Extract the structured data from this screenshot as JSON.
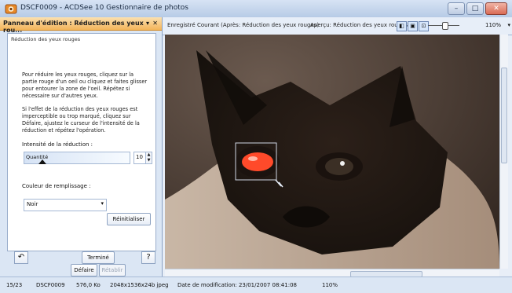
{
  "window": {
    "title": "DSCF0009 - ACDSee 10 Gestionnaire de photos",
    "buttons": {
      "minimize": "–",
      "maximize": "□",
      "close": "✕"
    }
  },
  "panel": {
    "title": "Panneau d'édition : Réduction des yeux rou...",
    "section_header": "Réduction des yeux rouges",
    "para1": "Pour réduire les yeux rouges, cliquez sur la partie rouge d'un oeil ou cliquez et faites glisser pour entourer la zone de l'oeil. Répétez si nécessaire sur d'autres yeux.",
    "para2": "Si l'effet de la réduction des yeux rouges est imperceptible ou trop marqué, cliquez sur Défaire, ajustez le curseur de l'intensité de la réduction et répétez l'opération.",
    "intensity_label": "Intensité de la réduction :",
    "quantity_label": "Quantité",
    "quantity_value": "10",
    "quantity_fraction": 0.1,
    "fill_color_label": "Couleur de remplissage :",
    "fill_color_value": "Noir",
    "reset_label": "Réinitialiser",
    "done_label": "Terminé",
    "undo_label": "Défaire",
    "redo_label": "Rétablir"
  },
  "toolbar": {
    "tab_saved": "Enregistré",
    "tab_current": "Courant (Après: Réduction des yeux rouges)",
    "tab_preview": "Aperçu: Réduction des yeux rouges",
    "zoom_value": "110%"
  },
  "statusbar": {
    "index": "15/23",
    "filename": "DSCF0009",
    "filesize": "576,0 Ko",
    "dimensions": "2048x1536x24b jpeg",
    "modified": "Date de modification: 23/01/2007 08:41:08",
    "zoom": "110%"
  },
  "colors": {
    "panel_header": "#f3b45a",
    "accent_blue": "#2d6bcf",
    "red_eye": "#ff4a2a"
  }
}
